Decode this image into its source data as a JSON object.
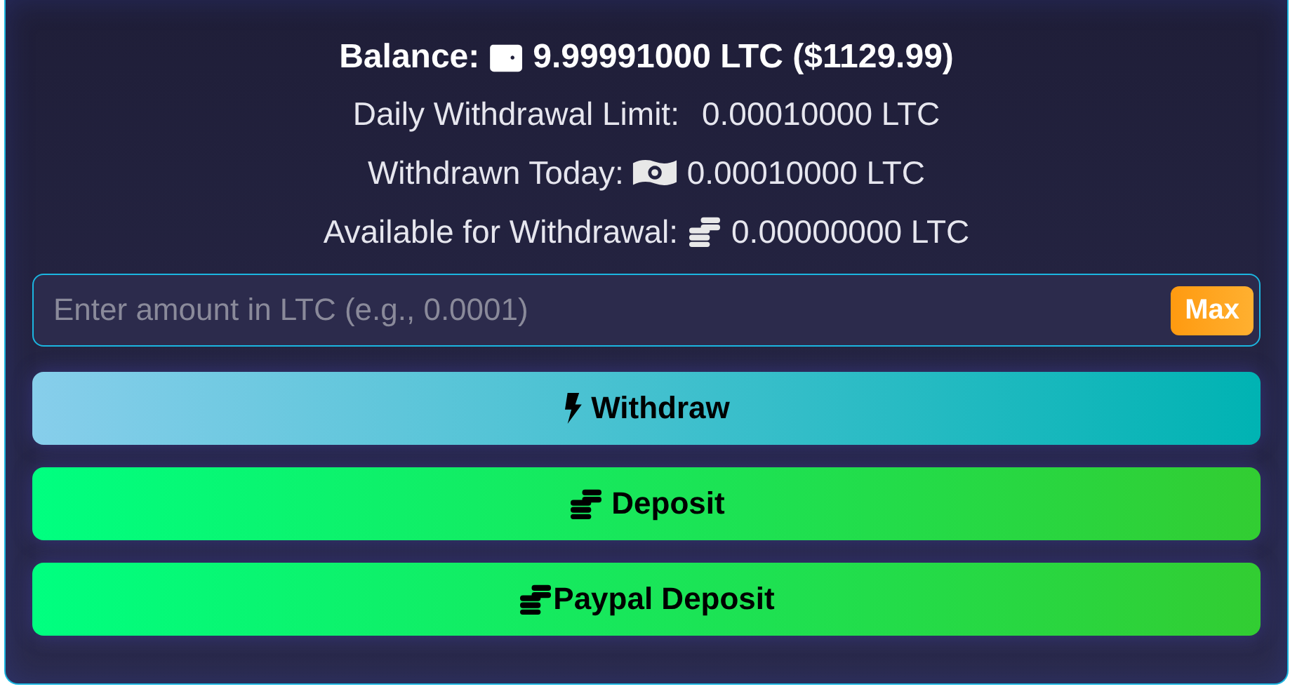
{
  "balance": {
    "label": "Balance:",
    "value": "9.99991000 LTC ($1129.99)"
  },
  "stats": [
    {
      "kind": "limit",
      "label": "Daily Withdrawal Limit:",
      "value": "0.00010000 LTC"
    },
    {
      "kind": "withdrawn",
      "label": "Withdrawn Today:",
      "value": "0.00010000 LTC"
    },
    {
      "kind": "available",
      "label": "Available for Withdrawal:",
      "value": "0.00000000 LTC"
    }
  ],
  "amount_field": {
    "placeholder": "Enter amount in LTC (e.g., 0.0001)",
    "max_button": "Max"
  },
  "buttons": [
    {
      "kind": "withdraw",
      "label": "Withdraw"
    },
    {
      "kind": "deposit",
      "label": "Deposit"
    },
    {
      "kind": "deposit",
      "label": "Paypal Deposit"
    }
  ]
}
